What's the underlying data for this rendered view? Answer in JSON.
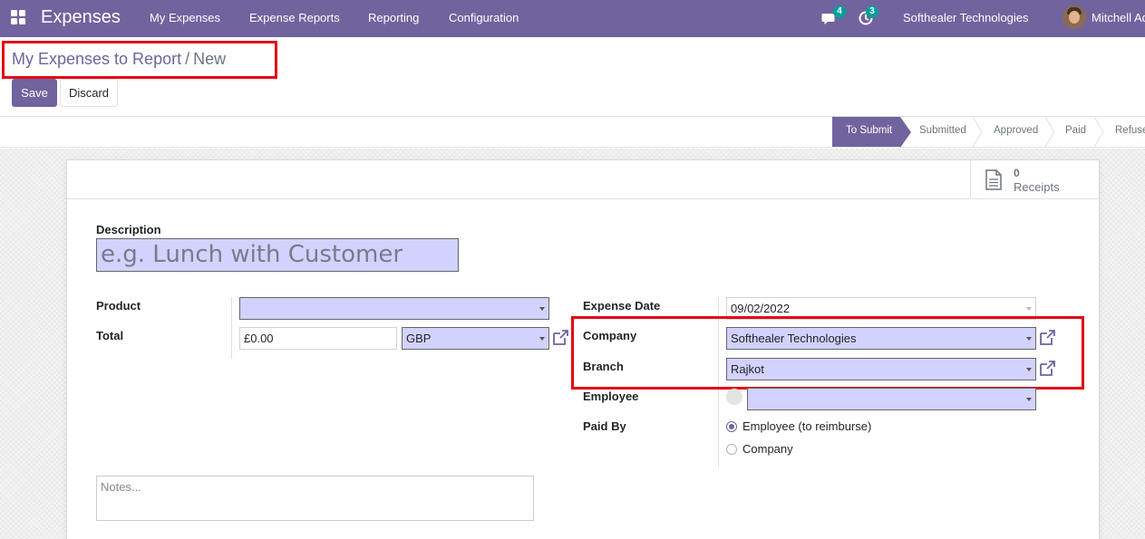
{
  "navbar": {
    "app_name": "Expenses",
    "menu": [
      "My Expenses",
      "Expense Reports",
      "Reporting",
      "Configuration"
    ],
    "messages_count": "4",
    "activities_count": "3",
    "company": "Softhealer Technologies",
    "user": "Mitchell Ad"
  },
  "breadcrumb": {
    "parent": "My Expenses to Report",
    "separator": "/",
    "current": "New"
  },
  "actions": {
    "save": "Save",
    "discard": "Discard"
  },
  "statusbar": {
    "stages": [
      "To Submit",
      "Submitted",
      "Approved",
      "Paid",
      "Refuse"
    ],
    "active": "To Submit"
  },
  "receipts": {
    "count": "0",
    "label": "Receipts"
  },
  "form": {
    "description_label": "Description",
    "description_placeholder": "e.g. Lunch with Customer",
    "product_label": "Product",
    "product_value": "",
    "total_label": "Total",
    "total_value": "£0.00",
    "currency_value": "GBP",
    "expense_date_label": "Expense Date",
    "expense_date_value": "09/02/2022",
    "company_label": "Company",
    "company_value": "Softhealer Technologies",
    "branch_label": "Branch",
    "branch_value": "Rajkot",
    "employee_label": "Employee",
    "employee_value": "",
    "paid_by_label": "Paid By",
    "paid_by_options": [
      "Employee (to reimburse)",
      "Company"
    ],
    "paid_by_selected": "Employee (to reimburse)",
    "notes_placeholder": "Notes..."
  },
  "colors": {
    "brand": "#71639e",
    "required_field": "#d2d2ff",
    "highlight": "#e30613",
    "badge": "#00a09d"
  }
}
